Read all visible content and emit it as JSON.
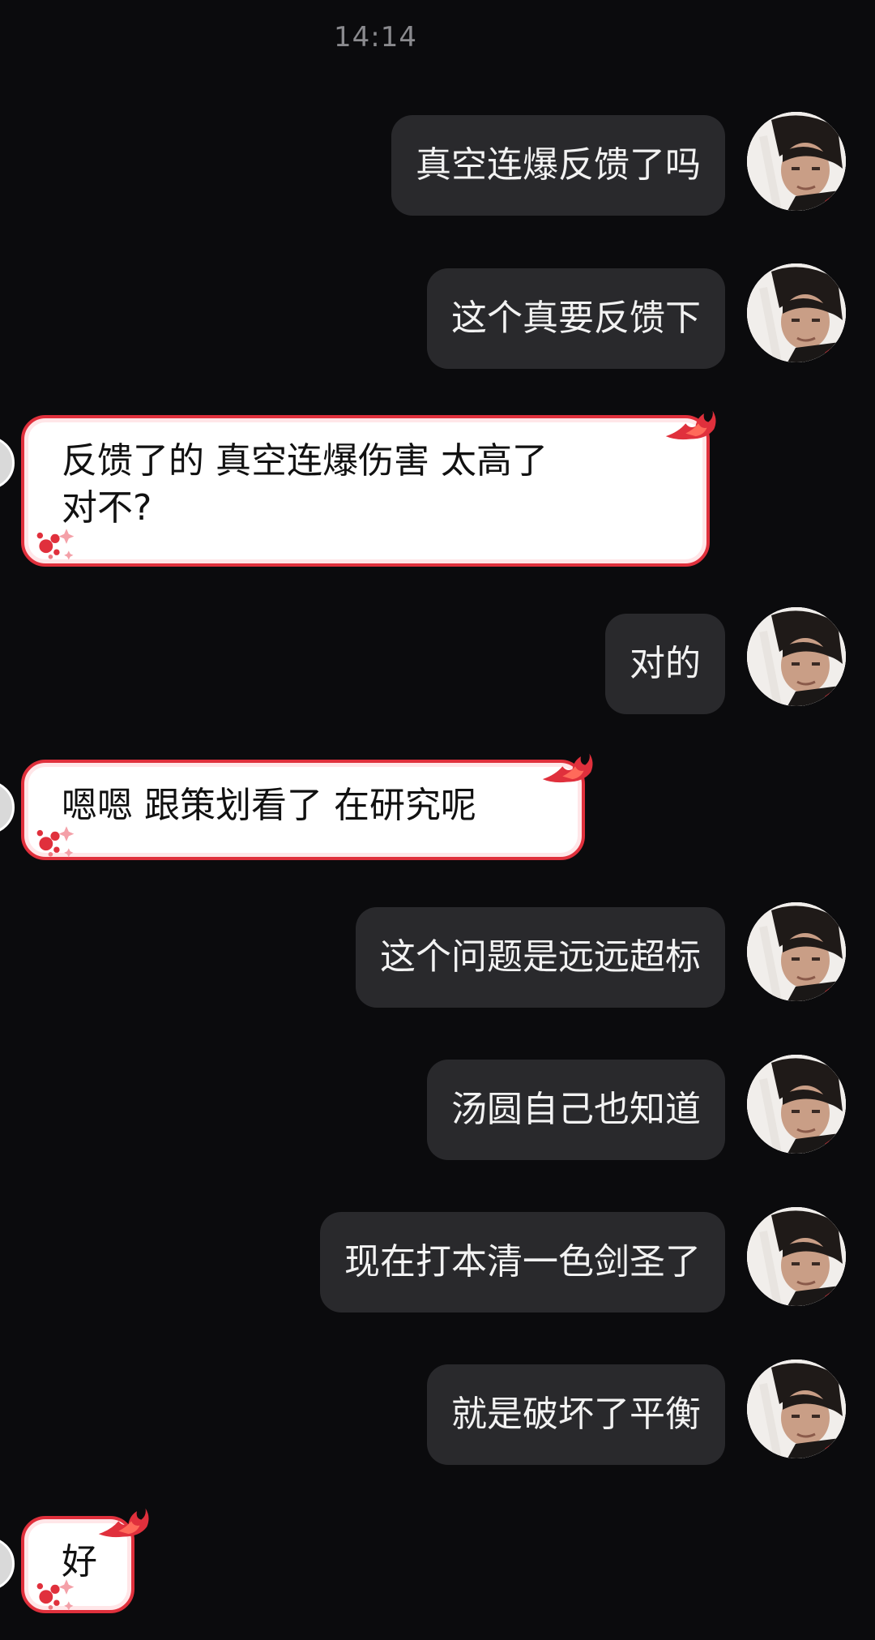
{
  "timestamp": "14:14",
  "messages": [
    {
      "side": "out",
      "text": "真空连爆反馈了吗"
    },
    {
      "side": "out",
      "text": "这个真要反馈下"
    },
    {
      "side": "in",
      "line1": "反馈了的 真空连爆伤害 太高了",
      "line2": "对不?"
    },
    {
      "side": "out",
      "text": "对的"
    },
    {
      "side": "in",
      "text": "嗯嗯 跟策划看了 在研究呢"
    },
    {
      "side": "out",
      "text": "这个问题是远远超标"
    },
    {
      "side": "out",
      "text": "汤圆自己也知道"
    },
    {
      "side": "out",
      "text": "现在打本清一色剑圣了"
    },
    {
      "side": "out",
      "text": "就是破坏了平衡"
    },
    {
      "side": "in",
      "text": "好"
    }
  ],
  "colors": {
    "background": "#0b0b0d",
    "outgoing_bubble": "#29292c",
    "incoming_bubble": "#ffffff",
    "incoming_border": "#e0303c"
  }
}
